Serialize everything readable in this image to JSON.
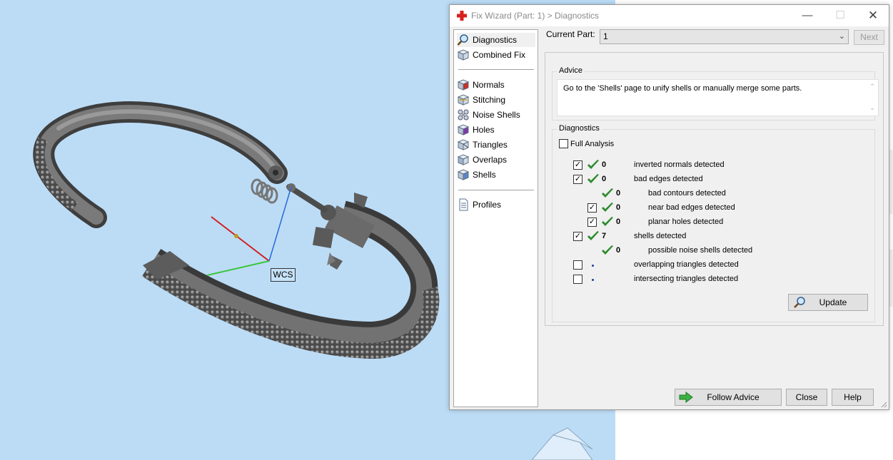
{
  "viewport": {
    "wcs_label": "WCS",
    "background": "#bcdcf6"
  },
  "dialog": {
    "title": "Fix Wizard (Part: 1) > Diagnostics",
    "window_buttons": [
      "minimize",
      "maximize",
      "close"
    ],
    "nav": {
      "group1": [
        {
          "label": "Diagnostics",
          "icon": "magnifier-icon",
          "selected": true
        },
        {
          "label": "Combined Fix",
          "icon": "cube-icon",
          "selected": false
        }
      ],
      "group2": [
        {
          "label": "Normals",
          "icon": "normals-cube-icon"
        },
        {
          "label": "Stitching",
          "icon": "stitching-cube-icon"
        },
        {
          "label": "Noise Shells",
          "icon": "noise-shells-icon"
        },
        {
          "label": "Holes",
          "icon": "holes-cube-icon"
        },
        {
          "label": "Triangles",
          "icon": "triangles-cube-icon"
        },
        {
          "label": "Overlaps",
          "icon": "overlaps-cube-icon"
        },
        {
          "label": "Shells",
          "icon": "shells-cube-icon"
        }
      ],
      "group3": [
        {
          "label": "Profiles",
          "icon": "document-icon"
        }
      ]
    },
    "current_part": {
      "label": "Current Part:",
      "value": "1",
      "next_label": "Next"
    },
    "advice": {
      "title": "Advice",
      "text": "Go to the 'Shells' page to unify shells or manually merge some parts."
    },
    "diagnostics": {
      "title": "Diagnostics",
      "full_analysis_label": "Full Analysis",
      "full_analysis_checked": false,
      "rows": [
        {
          "checkbox": true,
          "checked": true,
          "status": "ok",
          "count": "0",
          "label": "inverted normals detected",
          "indent": 0
        },
        {
          "checkbox": true,
          "checked": true,
          "status": "ok",
          "count": "0",
          "label": "bad edges detected",
          "indent": 0
        },
        {
          "checkbox": false,
          "checked": false,
          "status": "ok",
          "count": "0",
          "label": "bad contours detected",
          "indent": 1
        },
        {
          "checkbox": true,
          "checked": true,
          "status": "ok",
          "count": "0",
          "label": "near bad edges detected",
          "indent": 1
        },
        {
          "checkbox": true,
          "checked": true,
          "status": "ok",
          "count": "0",
          "label": "planar holes detected",
          "indent": 1
        },
        {
          "checkbox": true,
          "checked": true,
          "status": "ok",
          "count": "7",
          "label": "shells detected",
          "indent": 0
        },
        {
          "checkbox": false,
          "checked": false,
          "status": "ok",
          "count": "0",
          "label": "possible noise shells detected",
          "indent": 1
        },
        {
          "checkbox": true,
          "checked": false,
          "status": "pending",
          "count": "",
          "label": "overlapping triangles detected",
          "indent": 0
        },
        {
          "checkbox": true,
          "checked": false,
          "status": "pending",
          "count": "",
          "label": "intersecting triangles detected",
          "indent": 0
        }
      ],
      "update_label": "Update"
    },
    "footer": {
      "follow_advice_label": "Follow Advice",
      "close_label": "Close",
      "help_label": "Help"
    },
    "colors": {
      "check_green": "#2e8b2e",
      "pending_dot": "#1f3c9b",
      "title_icon_red": "#d9201c"
    }
  }
}
